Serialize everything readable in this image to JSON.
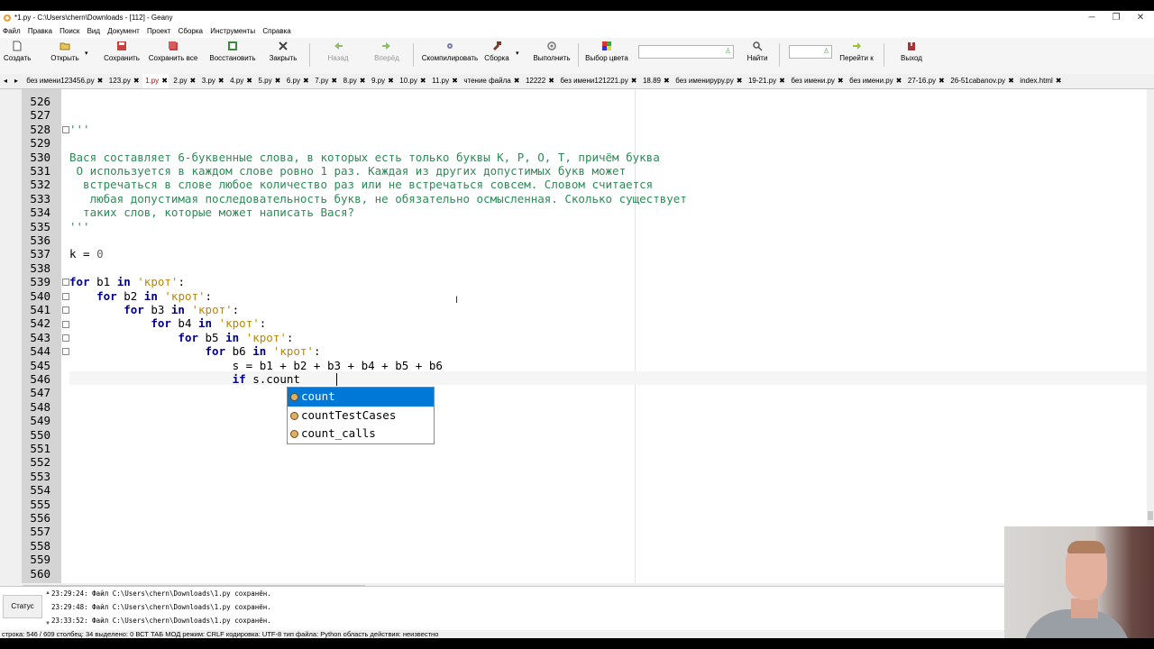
{
  "window": {
    "title": "*1.py - C:\\Users\\chern\\Downloads - [112] - Geany",
    "controls": [
      "─",
      "❐",
      "✕"
    ]
  },
  "menu": [
    "Файл",
    "Правка",
    "Поиск",
    "Вид",
    "Документ",
    "Проект",
    "Сборка",
    "Инструменты",
    "Справка"
  ],
  "toolbar": {
    "new": "Создать",
    "open": "Открыть",
    "save": "Сохранить",
    "save_all": "Сохранить все",
    "revert": "Восстановить",
    "close": "Закрыть",
    "back": "Назад",
    "forward": "Вперёд",
    "compile": "Скомпилировать",
    "build": "Сборка",
    "run": "Выполнить",
    "color": "Выбор цвета",
    "find": "Найти",
    "goto": "Перейти к",
    "quit": "Выход"
  },
  "tabs": [
    "без имени123456.py",
    "123.py",
    "1.py",
    "2.py",
    "3.py",
    "4.py",
    "5.py",
    "6.py",
    "7.py",
    "8.py",
    "9.py",
    "10.py",
    "11.py",
    "чтение файла",
    "12222",
    "без имени121221.py",
    "18.89",
    "без именируру.py",
    "19-21.py",
    "без имени.ру",
    "без имени.ру",
    "27-16.py",
    "26-51cabanov.py",
    "index.html"
  ],
  "active_tab": "1.py",
  "editor": {
    "line_numbers": [
      "526",
      "527",
      "528",
      "529",
      "530",
      "531",
      "532",
      "533",
      "534",
      "535",
      "536",
      "537",
      "538",
      "539",
      "540",
      "541",
      "542",
      "543",
      "544",
      "545",
      "546",
      "547",
      "548",
      "549",
      "550",
      "551",
      "552",
      "553",
      "554",
      "555",
      "556",
      "557",
      "558",
      "559",
      "560"
    ],
    "lines": {
      "l528": "'''",
      "l530": "Вася составляет 6-буквенные слова, в которых есть только буквы К, Р, О, Т, причём буква",
      "l531": " О используется в каждом слове ровно 1 раз. Каждая из других допустимых букв может",
      "l532": "  встречаться в слове любое количество раз или не встречаться совсем. Словом считается",
      "l533": "   любая допустимая последовательность букв, не обязательно осмысленная. Сколько существует",
      "l534": "  таких слов, которые может написать Вася?",
      "l535": "'''",
      "l537_a": "k = ",
      "l537_b": "0",
      "l539_kw1": "for",
      "l539_mid": " b1 ",
      "l539_kw2": "in",
      "l539_str": "'крот'",
      "l539_end": ":",
      "l540_ind": "    ",
      "l540_kw1": "for",
      "l540_mid": " b2 ",
      "l540_kw2": "in",
      "l540_str": "'крот'",
      "l540_end": ":",
      "l541_ind": "        ",
      "l541_kw1": "for",
      "l541_mid": " b3 ",
      "l541_kw2": "in",
      "l541_str": "'крот'",
      "l541_end": ":",
      "l542_ind": "            ",
      "l542_kw1": "for",
      "l542_mid": " b4 ",
      "l542_kw2": "in",
      "l542_str": "'крот'",
      "l542_end": ":",
      "l543_ind": "                ",
      "l543_kw1": "for",
      "l543_mid": " b5 ",
      "l543_kw2": "in",
      "l543_str": "'крот'",
      "l543_end": ":",
      "l544_ind": "                    ",
      "l544_kw1": "for",
      "l544_mid": " b6 ",
      "l544_kw2": "in",
      "l544_str": "'крот'",
      "l544_end": ":",
      "l545": "                        s = b1 + b2 + b3 + b4 + b5 + b6",
      "l546_ind": "                        ",
      "l546_kw": "if",
      "l546_rest": " s.count"
    }
  },
  "autocomplete": [
    "count",
    "countTestCases",
    "count_calls"
  ],
  "messages": [
    "23:29:24: Файл C:\\Users\\chern\\Downloads\\1.py сохранён.",
    "23:29:48: Файл C:\\Users\\chern\\Downloads\\1.py сохранён.",
    "23:33:52: Файл C:\\Users\\chern\\Downloads\\1.py сохранён."
  ],
  "message_tab": "Статус",
  "statusbar": "строка: 546 / 609   столбец: 34   выделено: 0   ВСТ     ТАБ     МОД     режим: CRLF     кодировка: UTF-8     тип файла: Python     область действия: неизвестно"
}
